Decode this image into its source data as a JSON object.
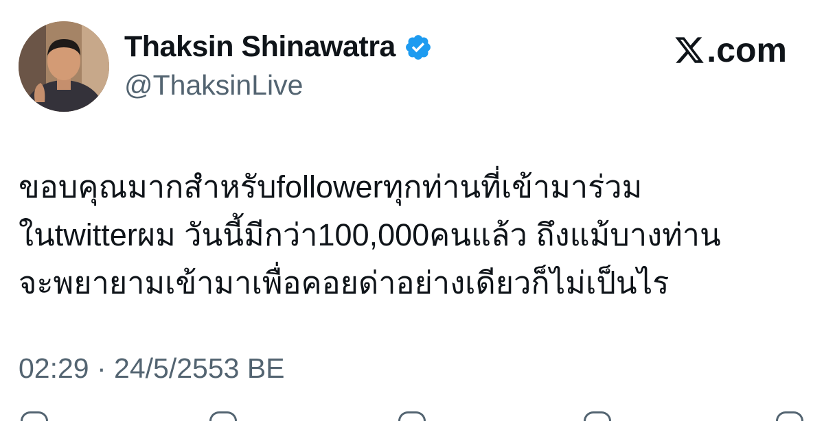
{
  "author": {
    "display_name": "Thaksin Shinawatra",
    "handle": "@ThaksinLive",
    "verified": true,
    "avatar_icon": "profile-photo"
  },
  "brand": {
    "text": ".com",
    "logo_icon": "x-logo-icon"
  },
  "tweet": {
    "lines": [
      "ขอบคุณมากสำหรับfollowerทุกท่านที่เข้ามาร่วม",
      "ในtwitterผม วันนี้มีกว่า100,000คนแล้ว ถึงแม้บางท่าน",
      "จะพยายามเข้ามาเพื่อคอยด่าอย่างเดียวก็ไม่เป็นไร"
    ],
    "timestamp": "02:29 · 24/5/2553 BE"
  },
  "actions": [
    {
      "icon": "reply-icon"
    },
    {
      "icon": "retweet-icon"
    },
    {
      "icon": "like-icon"
    },
    {
      "icon": "bookmark-icon"
    },
    {
      "icon": "share-icon"
    }
  ],
  "colors": {
    "text_primary": "#0f1419",
    "text_secondary": "#536471",
    "verified_blue": "#1d9bf0",
    "background": "#ffffff"
  }
}
